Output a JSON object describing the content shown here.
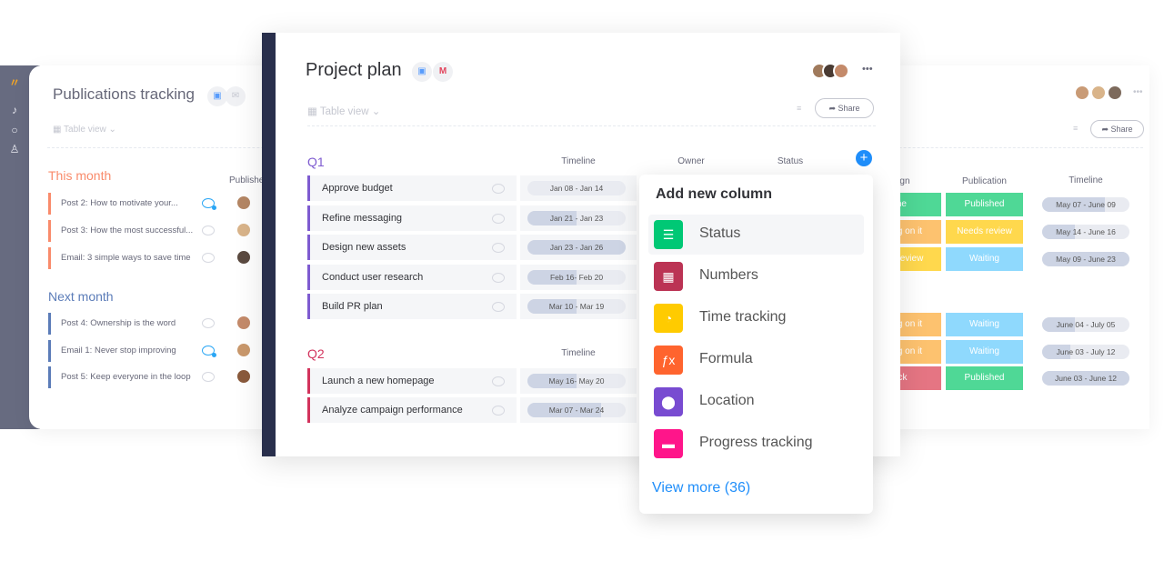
{
  "back_board": {
    "title": "Publications tracking",
    "view_label": "Table view",
    "share_label": "Share",
    "more_label": "•••",
    "publisher_header": "Publisher",
    "design_header": "Design",
    "publication_header": "Publication",
    "timeline_header": "Timeline",
    "groups": [
      {
        "name": "This month",
        "color": "#f98b6b",
        "rows": [
          {
            "name": "Post 2: How to motivate your...",
            "unread": true,
            "design": "Done",
            "design_color": "#4fd896",
            "publication": "Published",
            "pub_color": "#4fd896",
            "timeline": "May 07 - June 09",
            "progress": 0.72
          },
          {
            "name": "Post 3: How the most successful...",
            "unread": false,
            "design": "Working on it",
            "design_color": "#fdc26f",
            "publication": "Needs review",
            "pub_color": "#ffd84d",
            "timeline": "May 14 - June 16",
            "progress": 0.38
          },
          {
            "name": "Email: 3 simple ways to save time",
            "unread": false,
            "design": "Needs review",
            "design_color": "#ffd84d",
            "publication": "Waiting",
            "pub_color": "#8fd9fd",
            "timeline": "May 09 - June 23",
            "progress": 1.0
          }
        ]
      },
      {
        "name": "Next month",
        "color": "#5b7cb8",
        "rows": [
          {
            "name": "Post 4: Ownership is the word",
            "unread": false,
            "design": "Working on it",
            "design_color": "#fdc26f",
            "publication": "Waiting",
            "pub_color": "#8fd9fd",
            "timeline": "June 04 - July 05",
            "progress": 0.38
          },
          {
            "name": "Email 1: Never stop improving",
            "unread": true,
            "design": "Working on it",
            "design_color": "#fdc26f",
            "publication": "Waiting",
            "pub_color": "#8fd9fd",
            "timeline": "June 03 - July 12",
            "progress": 0.32
          },
          {
            "name": "Post 5: Keep everyone in the loop",
            "unread": false,
            "design": "Stuck",
            "design_color": "#e57583",
            "publication": "Published",
            "pub_color": "#4fd896",
            "timeline": "June 03 - June 12",
            "progress": 1.0
          }
        ]
      }
    ]
  },
  "project_board": {
    "title": "Project plan",
    "view_label": "Table view",
    "share_label": "Share",
    "more_label": "•••",
    "groups": [
      {
        "name": "Q1",
        "color": "#7e5bd0",
        "headers": [
          "Timeline",
          "Owner",
          "Status"
        ],
        "rows": [
          {
            "name": "Approve budget",
            "timeline": "Jan 08 - Jan 14",
            "progress": 0.0
          },
          {
            "name": "Refine messaging",
            "timeline": "Jan 21 - Jan 23",
            "progress": 0.5
          },
          {
            "name": "Design new assets",
            "timeline": "Jan 23 - Jan 26",
            "progress": 1.0
          },
          {
            "name": "Conduct user research",
            "timeline": "Feb 16- Feb 20",
            "progress": 0.5
          },
          {
            "name": "Build PR plan",
            "timeline": "Mar 10 - Mar 19",
            "progress": 0.5
          }
        ]
      },
      {
        "name": "Q2",
        "color": "#d2335c",
        "headers": [
          "Timeline"
        ],
        "rows": [
          {
            "name": "Launch a new homepage",
            "timeline": "May 16- May 20",
            "progress": 0.5
          },
          {
            "name": "Analyze campaign performance",
            "timeline": "Mar 07 - Mar 24",
            "progress": 0.75
          }
        ]
      }
    ]
  },
  "add_column_popup": {
    "title": "Add new column",
    "items": [
      {
        "label": "Status",
        "icon": "status-icon",
        "color": "#00c875"
      },
      {
        "label": "Numbers",
        "icon": "calculator-icon",
        "color": "#bb3354"
      },
      {
        "label": "Time tracking",
        "icon": "timer-icon",
        "color": "#ffcb00"
      },
      {
        "label": "Formula",
        "icon": "formula-icon",
        "color": "#ff642e"
      },
      {
        "label": "Location",
        "icon": "location-pin-icon",
        "color": "#784bd1"
      },
      {
        "label": "Progress tracking",
        "icon": "progress-icon",
        "color": "#ff158a"
      }
    ],
    "view_more": "View more (36)"
  },
  "accent_color": "#1f8efa"
}
